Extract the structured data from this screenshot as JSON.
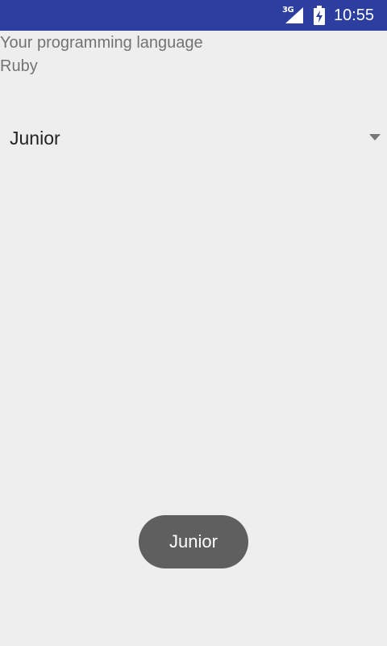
{
  "status_bar": {
    "network_type": "3G",
    "time": "10:55",
    "icons": [
      "signal-icon",
      "battery-charging-icon"
    ]
  },
  "main": {
    "language_label": "Your programming language",
    "language_value": "Ruby"
  },
  "spinner": {
    "selected_value": "Junior",
    "icon": "dropdown-arrow-icon"
  },
  "toast": {
    "message": "Junior"
  },
  "colors": {
    "status_bar_bg": "#2c3e9f",
    "background": "#eeeeee",
    "toast_bg": "#5f5f5f"
  }
}
